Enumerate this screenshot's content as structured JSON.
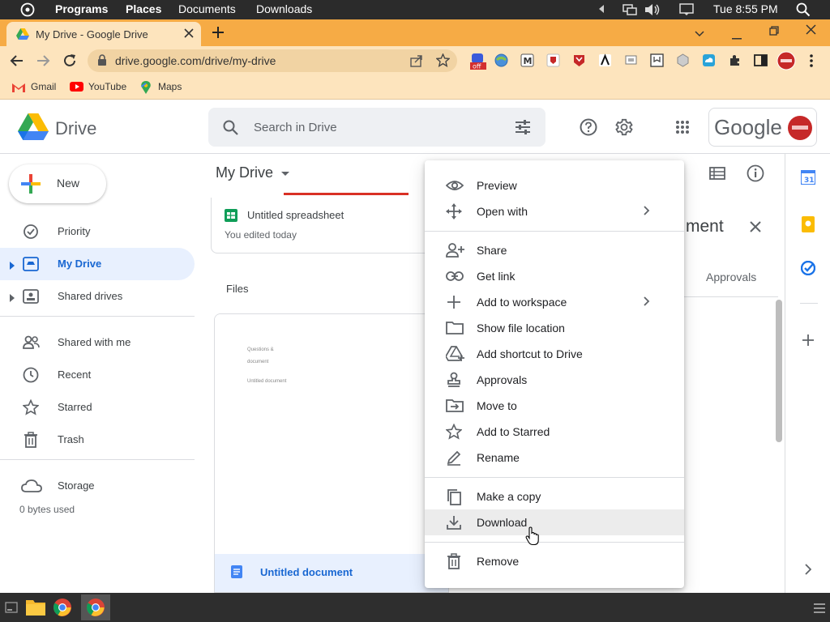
{
  "os_bar": {
    "menus": [
      "Programs",
      "Places",
      "Documents",
      "Downloads"
    ],
    "clock": "Tue 8:55 PM"
  },
  "browser": {
    "tab_title": "My Drive - Google Drive",
    "url": "drive.google.com/drive/my-drive",
    "bookmarks": [
      "Gmail",
      "YouTube",
      "Maps"
    ]
  },
  "drive": {
    "app_name": "Drive",
    "search_placeholder": "Search in Drive",
    "brand": "Google",
    "new_label": "New",
    "breadcrumb": "My Drive",
    "nav": [
      {
        "label": "Priority",
        "icon": "checkbox-icon"
      },
      {
        "label": "My Drive",
        "icon": "drive-folder-icon"
      },
      {
        "label": "Shared drives",
        "icon": "shared-drives-icon"
      },
      {
        "label": "Shared with me",
        "icon": "people-icon"
      },
      {
        "label": "Recent",
        "icon": "clock-icon"
      },
      {
        "label": "Starred",
        "icon": "star-icon"
      },
      {
        "label": "Trash",
        "icon": "trash-icon"
      },
      {
        "label": "Storage",
        "icon": "cloud-icon"
      }
    ],
    "storage_used": "0 bytes used",
    "suggested": {
      "name": "Untitled spreadsheet",
      "subtitle": "You edited today"
    },
    "files_label": "Files",
    "file_card": {
      "name": "Untitled document",
      "thumb_lines": [
        "Questions &",
        "document",
        "Untitled document"
      ]
    },
    "details_panel": {
      "title_fragment": "ment",
      "tab": "Approvals"
    }
  },
  "context_menu": {
    "items": [
      {
        "label": "Preview",
        "icon": "eye-icon"
      },
      {
        "label": "Open with",
        "icon": "move-arrows-icon",
        "submenu": true
      },
      {
        "label": "Share",
        "icon": "person-add-icon"
      },
      {
        "label": "Get link",
        "icon": "link-icon"
      },
      {
        "label": "Add to workspace",
        "icon": "plus-icon",
        "submenu": true
      },
      {
        "label": "Show file location",
        "icon": "folder-icon"
      },
      {
        "label": "Add shortcut to Drive",
        "icon": "drive-shortcut-icon"
      },
      {
        "label": "Approvals",
        "icon": "stamp-icon"
      },
      {
        "label": "Move to",
        "icon": "move-to-icon"
      },
      {
        "label": "Add to Starred",
        "icon": "star-icon"
      },
      {
        "label": "Rename",
        "icon": "pencil-icon"
      },
      {
        "label": "Make a copy",
        "icon": "copy-icon"
      },
      {
        "label": "Download",
        "icon": "download-icon"
      },
      {
        "label": "Remove",
        "icon": "trash-icon"
      }
    ],
    "hovered": "Download"
  },
  "colors": {
    "tabstrip": "#f6ab45",
    "toolbar": "#fde4bd",
    "active_nav_bg": "#e8f0fe",
    "active_nav_text": "#1967d2",
    "tab_underline": "#d93025"
  }
}
